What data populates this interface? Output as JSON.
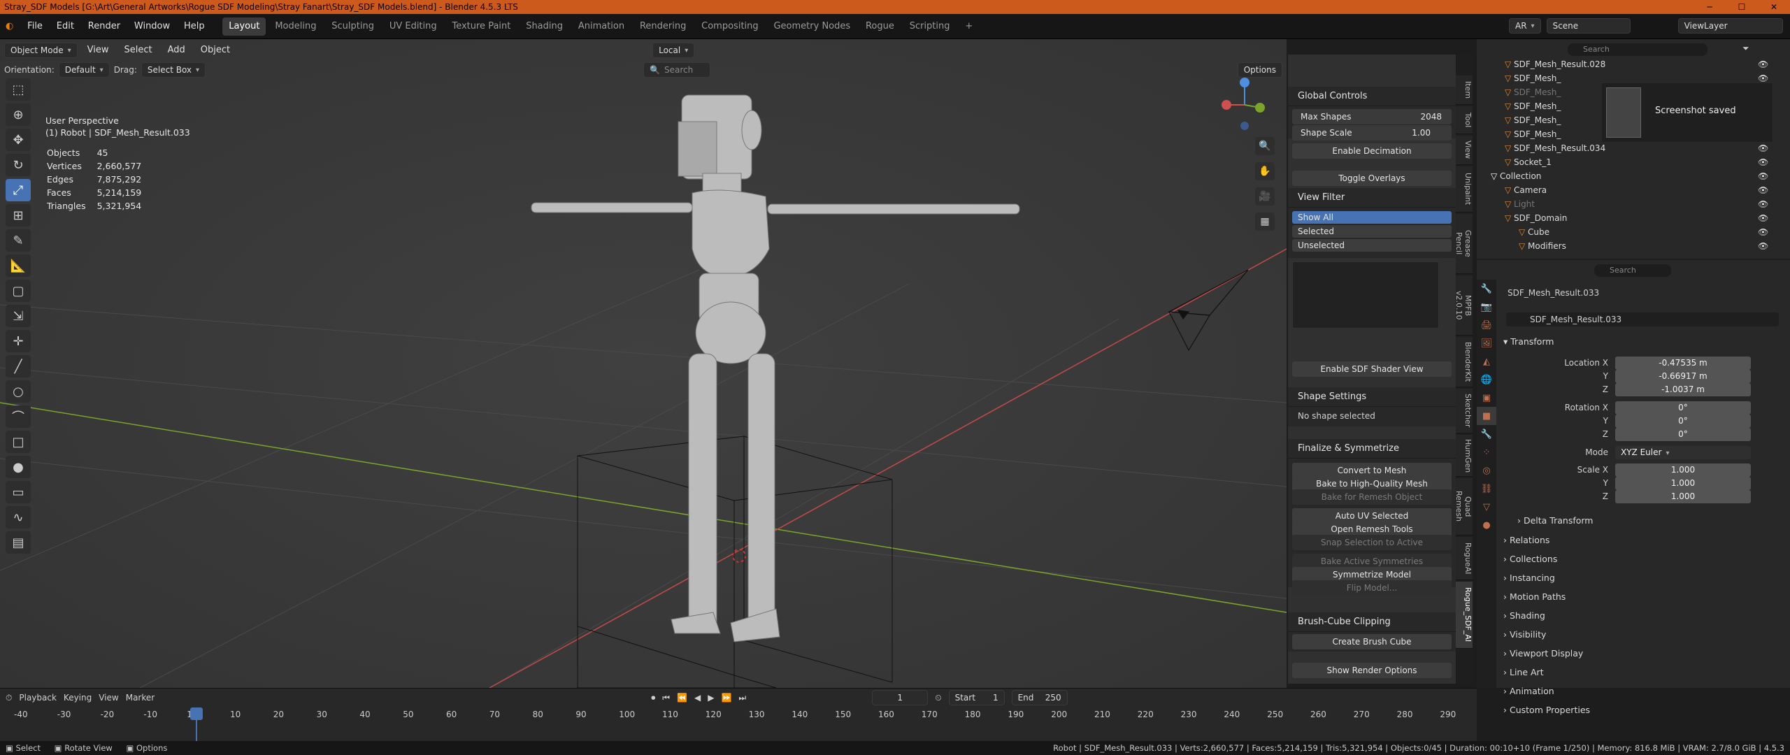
{
  "window": {
    "title": "Stray_SDF Models [G:\\Art\\General Artworks\\Rogue SDF Modeling\\Stray Fanart\\Stray_SDF Models.blend] - Blender 4.5.3 LTS",
    "minimize": "─",
    "maximize": "☐",
    "close": "✕"
  },
  "menu": [
    "File",
    "Edit",
    "Render",
    "Window",
    "Help"
  ],
  "workspaces": [
    "Layout",
    "Modeling",
    "Sculpting",
    "UV Editing",
    "Texture Paint",
    "Shading",
    "Animation",
    "Rendering",
    "Compositing",
    "Geometry Nodes",
    "Rogue",
    "Scripting"
  ],
  "workspace_add": "+",
  "active_workspace": "Layout",
  "top_right": {
    "renderer": "AR",
    "scene": "Scene",
    "viewlayer": "ViewLayer"
  },
  "viewport_header": {
    "mode": "Object Mode",
    "menus": [
      "View",
      "Select",
      "Add",
      "Object"
    ],
    "transform": "Local",
    "orientation_label": "Orientation:",
    "orientation": "Default",
    "drag_label": "Drag:",
    "drag": "Select Box",
    "search_placeholder": "Search",
    "options": "Options"
  },
  "viewport_info": {
    "perspective": "User Perspective",
    "object": "(1) Robot | SDF_Mesh_Result.033"
  },
  "stats": [
    [
      "Objects",
      "45"
    ],
    [
      "Vertices",
      "2,660,577"
    ],
    [
      "Edges",
      "7,875,292"
    ],
    [
      "Faces",
      "5,214,159"
    ],
    [
      "Triangles",
      "5,321,954"
    ]
  ],
  "npanel": {
    "global_controls": "Global Controls",
    "max_shapes_label": "Max Shapes",
    "max_shapes": "2048",
    "shape_scale_label": "Shape Scale",
    "shape_scale": "1.00",
    "enable_decimation": "Enable Decimation",
    "toggle_overlays": "Toggle Overlays",
    "view_filter": "View Filter",
    "filters": [
      "Show All",
      "Selected",
      "Unselected"
    ],
    "enable_sdf_shader": "Enable SDF Shader View",
    "shape_settings": "Shape Settings",
    "no_shape": "No shape selected",
    "finalize": "Finalize & Symmetrize",
    "finalize_buttons": [
      {
        "label": "Convert to Mesh",
        "enabled": true
      },
      {
        "label": "Bake to High-Quality Mesh",
        "enabled": true
      },
      {
        "label": "Bake for Remesh Object",
        "enabled": false
      },
      {
        "label": "Auto UV Selected",
        "enabled": true
      },
      {
        "label": "Open Remesh Tools",
        "enabled": true
      },
      {
        "label": "Snap Selection to Active",
        "enabled": false
      },
      {
        "label": "Bake Active Symmetries",
        "enabled": false
      },
      {
        "label": "Symmetrize Model",
        "enabled": true
      },
      {
        "label": "Flip Model...",
        "enabled": false
      }
    ],
    "brush_cube": "Brush-Cube Clipping",
    "create_brush_cube": "Create Brush Cube",
    "show_render": "Show Render Options"
  },
  "ntabs": [
    "Item",
    "Tool",
    "View",
    "Unipaint",
    "Grease Pencil",
    "MPFB v2.0.10",
    "BlenderKit",
    "Sketcher",
    "HumGen",
    "Quad Remesh",
    "RogueAI",
    "Rogue_SDF_AI"
  ],
  "outliner": {
    "search_placeholder": "Search",
    "rows": [
      {
        "label": "SDF_Mesh_Result.028",
        "indent": 1,
        "dim": false
      },
      {
        "label": "SDF_Mesh_",
        "indent": 1,
        "dim": false
      },
      {
        "label": "SDF_Mesh_",
        "indent": 1,
        "dim": true
      },
      {
        "label": "SDF_Mesh_",
        "indent": 1,
        "dim": false
      },
      {
        "label": "SDF_Mesh_",
        "indent": 1,
        "dim": false
      },
      {
        "label": "SDF_Mesh_",
        "indent": 1,
        "dim": false
      },
      {
        "label": "SDF_Mesh_Result.034",
        "indent": 1,
        "dim": false
      },
      {
        "label": "Socket_1",
        "indent": 1,
        "dim": false
      },
      {
        "label": "Collection",
        "indent": 0,
        "dim": false
      },
      {
        "label": "Camera",
        "indent": 1,
        "dim": false
      },
      {
        "label": "Light",
        "indent": 1,
        "dim": true
      },
      {
        "label": "SDF_Domain",
        "indent": 1,
        "dim": false
      },
      {
        "label": "Cube",
        "indent": 2,
        "dim": false
      },
      {
        "label": "Modifiers",
        "indent": 2,
        "dim": false
      }
    ],
    "toast": "Screenshot saved"
  },
  "properties": {
    "search_placeholder": "Search",
    "object_name": "SDF_Mesh_Result.033",
    "datablock": "SDF_Mesh_Result.033",
    "transform": "Transform",
    "location_label": "Location X",
    "loc": [
      "-0.47535 m",
      "-0.66917 m",
      "-1.0037 m"
    ],
    "rotation_label": "Rotation X",
    "rot": [
      "0°",
      "0°",
      "0°"
    ],
    "mode_label": "Mode",
    "mode": "XYZ Euler",
    "scale_label": "Scale X",
    "scale": [
      "1.000",
      "1.000",
      "1.000"
    ],
    "axis_y": "Y",
    "axis_z": "Z",
    "delta": "Delta Transform",
    "sections": [
      "Relations",
      "Collections",
      "Instancing",
      "Motion Paths",
      "Shading",
      "Visibility",
      "Viewport Display",
      "Line Art",
      "Animation",
      "Custom Properties"
    ]
  },
  "timeline": {
    "menus": [
      "Playback",
      "Keying",
      "View",
      "Marker"
    ],
    "current": "1",
    "start_label": "Start",
    "start": "1",
    "end_label": "End",
    "end": "250",
    "ticks": [
      "-40",
      "-30",
      "-20",
      "-10",
      "1",
      "10",
      "20",
      "30",
      "40",
      "50",
      "60",
      "70",
      "80",
      "90",
      "100",
      "110",
      "120",
      "130",
      "140",
      "150",
      "160",
      "170",
      "180",
      "190",
      "200",
      "210",
      "220",
      "230",
      "240",
      "250",
      "260",
      "270",
      "280",
      "290"
    ]
  },
  "statusbar": {
    "left": [
      "Select",
      "Rotate View",
      "Options"
    ],
    "right": "Robot | SDF_Mesh_Result.033 | Verts:2,660,577 | Faces:5,214,159 | Tris:5,321,954 | Objects:0/45 | Duration: 00:10+10 (Frame 1/250) | Memory: 816.8 MiB | VRAM: 2.7/8.0 GiB | 4.5.3"
  },
  "colors": {
    "accent": "#4772b3",
    "title": "#cc5a1c",
    "x_axis": "#c34a4a",
    "y_axis": "#7aa52a"
  }
}
